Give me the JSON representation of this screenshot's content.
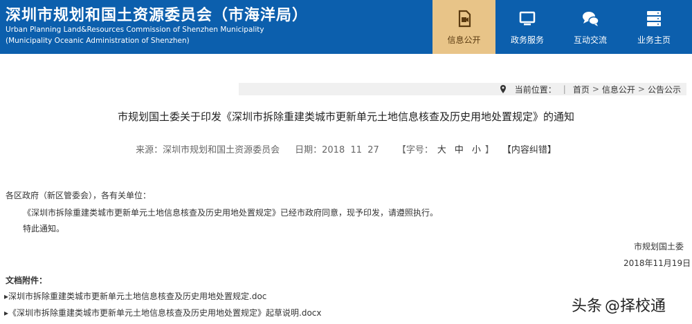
{
  "header": {
    "title": "深圳市规划和国土资源委员会（市海洋局）",
    "subtitle_en1": "Urban Planning Land&Resources Commission of Shenzhen Municipality",
    "subtitle_en2": "(Municipality Oceanic Administration of Shenzhen)",
    "bg_color": "#0c5fad",
    "active_color": "#e8c488"
  },
  "nav": [
    {
      "label": "信息公开",
      "icon": "document-video-icon",
      "active": true
    },
    {
      "label": "政务服务",
      "icon": "monitor-icon",
      "active": false
    },
    {
      "label": "互动交流",
      "icon": "chat-bubbles-icon",
      "active": false
    },
    {
      "label": "业务主页",
      "icon": "server-icon",
      "active": false
    }
  ],
  "breadcrumb": {
    "label": "当前位置：",
    "items": [
      "首页",
      "信息公开",
      "公告公示"
    ],
    "separator": ">",
    "divider": "|"
  },
  "article": {
    "title": "市规划国土委关于印发《深圳市拆除重建类城市更新单元土地信息核查及历史用地处置规定》的通知",
    "source_label": "来源：",
    "source": "深圳市规划和国土资源委员会",
    "date_label": "日期：",
    "date": "2018  11  27",
    "fontsize_label": "【字号：",
    "font_large": "大",
    "font_medium": "中",
    "font_small": "小",
    "fontsize_close": "】",
    "error_link": "【内容纠错】",
    "salutation": "各区政府（新区管委会），各有关单位：",
    "paragraph1": "《深圳市拆除重建类城市更新单元土地信息核查及历史用地处置规定》已经市政府同意，现予印发，请遵照执行。",
    "paragraph2": "特此通知。",
    "signature": "市规划国土委",
    "sign_date": "2018年11月19日"
  },
  "attachments": {
    "label": "文档附件：",
    "items": [
      "▸深圳市拆除重建类城市更新单元土地信息核查及历史用地处置规定.doc",
      "▸《深圳市拆除重建类城市更新单元土地信息核查及历史用地处置规定》起草说明.docx"
    ]
  },
  "watermark": {
    "text1": "头条",
    "text2": "@择校通"
  }
}
